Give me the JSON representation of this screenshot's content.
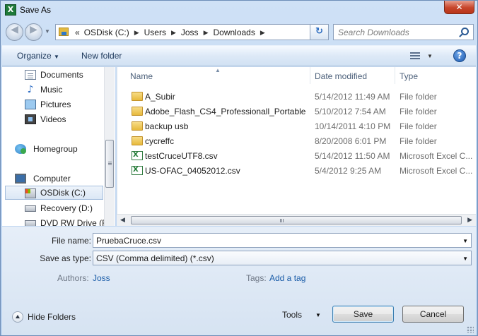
{
  "window": {
    "title": "Save As",
    "app_icon_letter": "X",
    "close_glyph": "✕"
  },
  "navigation": {
    "back_glyph": "◀",
    "forward_glyph": "▶",
    "breadcrumbs": [
      "OSDisk (C:)",
      "Users",
      "Joss",
      "Downloads"
    ],
    "overflow_glyph": "«",
    "refresh_glyph": "↻",
    "search_placeholder": "Search Downloads"
  },
  "toolbar": {
    "organize_label": "Organize",
    "new_folder_label": "New folder",
    "help_glyph": "?"
  },
  "sidebar": {
    "libraries": [
      {
        "label": "Documents",
        "icon": "documents-icon"
      },
      {
        "label": "Music",
        "icon": "music-icon"
      },
      {
        "label": "Pictures",
        "icon": "pictures-icon"
      },
      {
        "label": "Videos",
        "icon": "videos-icon"
      }
    ],
    "homegroup": "Homegroup",
    "computer": "Computer",
    "drives": [
      {
        "label": "OSDisk (C:)",
        "selected": true
      },
      {
        "label": "Recovery (D:)",
        "selected": false
      },
      {
        "label": "DVD RW Drive (F:",
        "selected": false
      }
    ]
  },
  "file_list": {
    "columns": {
      "name": "Name",
      "date": "Date modified",
      "type": "Type"
    },
    "rows": [
      {
        "name": "A_Subir",
        "date": "5/14/2012 11:49 AM",
        "type": "File folder",
        "icon": "folder-icon"
      },
      {
        "name": "Adobe_Flash_CS4_Professionall_Portable",
        "date": "5/10/2012 7:54 AM",
        "type": "File folder",
        "icon": "folder-icon"
      },
      {
        "name": "backup usb",
        "date": "10/14/2011 4:10 PM",
        "type": "File folder",
        "icon": "folder-icon"
      },
      {
        "name": "cycreffc",
        "date": "8/20/2008 6:01 PM",
        "type": "File folder",
        "icon": "folder-icon"
      },
      {
        "name": "testCruceUTF8.csv",
        "date": "5/14/2012 11:50 AM",
        "type": "Microsoft Excel C...",
        "icon": "excel-csv-icon"
      },
      {
        "name": "US-OFAC_04052012.csv",
        "date": "5/4/2012 9:25 AM",
        "type": "Microsoft Excel C...",
        "icon": "excel-csv-icon"
      }
    ]
  },
  "form": {
    "file_name_label": "File name:",
    "file_name_value": "PruebaCruce.csv",
    "save_type_label": "Save as type:",
    "save_type_value": "CSV (Comma delimited) (*.csv)",
    "authors_label": "Authors:",
    "authors_value": "Joss",
    "tags_label": "Tags:",
    "tags_value": "Add a tag"
  },
  "footer": {
    "hide_folders_label": "Hide Folders",
    "tools_label": "Tools",
    "save_label": "Save",
    "cancel_label": "Cancel"
  },
  "colors": {
    "accent_link": "#1a5ca8",
    "folder": "#e7b93c",
    "close_button": "#c7452b"
  }
}
